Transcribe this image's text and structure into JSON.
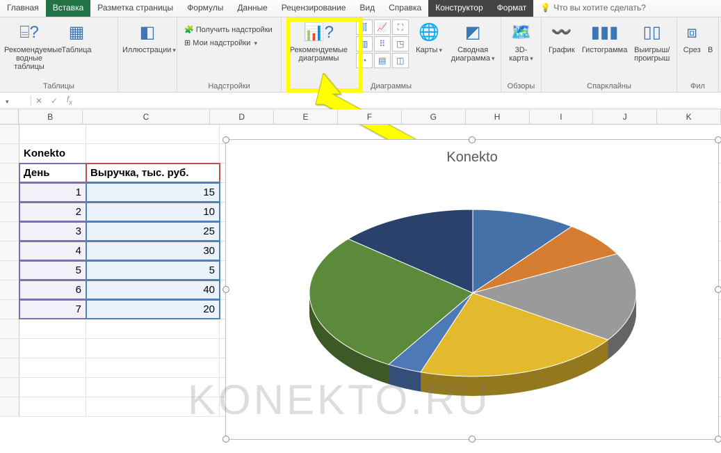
{
  "tabs": {
    "home": "Главная",
    "insert": "Вставка",
    "layout": "Разметка страницы",
    "formulas": "Формулы",
    "data": "Данные",
    "review": "Рецензирование",
    "view": "Вид",
    "help": "Справка",
    "design": "Конструктор",
    "format": "Формат",
    "tell": "Что вы хотите сделать?"
  },
  "ribbon": {
    "tables_group": "Таблицы",
    "addins_group": "Надстройки",
    "charts_group": "Диаграммы",
    "tours_group": "Обзоры",
    "sparklines_group": "Спарклайны",
    "filters_group": "Фил",
    "recommended_tables_l1": "Рекомендуемые",
    "recommended_tables_l2": "водные таблицы",
    "table": "Таблица",
    "illustrations": "Иллюстрации",
    "get_addins": "Получить надстройки",
    "my_addins": "Мои надстройки",
    "recommended_charts_l1": "Рекомендуемые",
    "recommended_charts_l2": "диаграммы",
    "maps": "Карты",
    "pivot_chart_l1": "Сводная",
    "pivot_chart_l2": "диаграмма",
    "map3d_l1": "3D-",
    "map3d_l2": "карта",
    "spark_line": "График",
    "spark_col": "Гистограмма",
    "spark_winloss_l1": "Выигрыш/",
    "spark_winloss_l2": "проигрыш",
    "slicer": "Срез",
    "extra": "В"
  },
  "columns": [
    "B",
    "C",
    "D",
    "E",
    "F",
    "G",
    "H",
    "I",
    "J",
    "K"
  ],
  "table": {
    "title": "Konekto",
    "header_day": "День",
    "header_rev": "Выручка, тыс. руб.",
    "rows": [
      {
        "day": "1",
        "rev": "15"
      },
      {
        "day": "2",
        "rev": "10"
      },
      {
        "day": "3",
        "rev": "25"
      },
      {
        "day": "4",
        "rev": "30"
      },
      {
        "day": "5",
        "rev": "5"
      },
      {
        "day": "6",
        "rev": "40"
      },
      {
        "day": "7",
        "rev": "20"
      }
    ]
  },
  "chart_title": "Konekto",
  "watermark": "KONEKTO.RU",
  "chart_data": {
    "type": "pie",
    "title": "Konekto",
    "categories": [
      "1",
      "2",
      "3",
      "4",
      "5",
      "6",
      "7"
    ],
    "values": [
      15,
      10,
      25,
      30,
      5,
      40,
      20
    ],
    "series_name": "Выручка, тыс. руб.",
    "colors": [
      "#4472a8",
      "#d77d31",
      "#9a9a9a",
      "#e3b92e",
      "#4e79b7",
      "#5b8a3a",
      "#29416b"
    ]
  }
}
